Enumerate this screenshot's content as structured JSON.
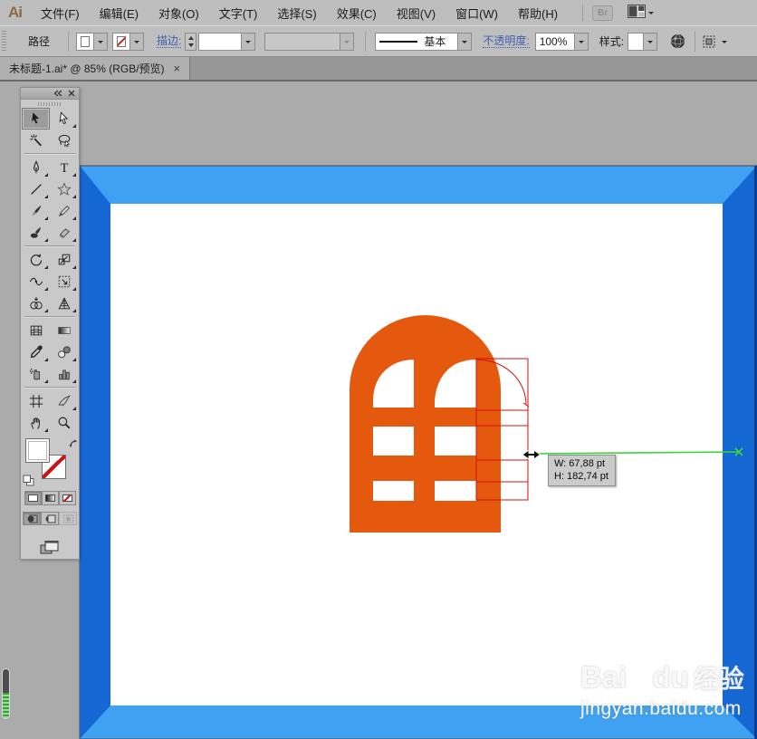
{
  "app": {
    "logo_label": "Ai"
  },
  "menu": {
    "items": [
      "文件(F)",
      "编辑(E)",
      "对象(O)",
      "文字(T)",
      "选择(S)",
      "效果(C)",
      "视图(V)",
      "窗口(W)",
      "帮助(H)"
    ],
    "bridge_button": "Br"
  },
  "control_bar": {
    "context_label": "路径",
    "stroke_label": "描边:",
    "brush_definition": "基本",
    "opacity_label": "不透明度:",
    "opacity_value": "100%",
    "style_label": "样式:"
  },
  "tab": {
    "title": "未标题-1.ai* @ 85% (RGB/预览)",
    "close_glyph": "×"
  },
  "selected_tool": "selection",
  "tools": [
    "selection",
    "direct-selection",
    "magic-wand",
    "lasso",
    "pen",
    "type",
    "line-segment",
    "star",
    "paintbrush",
    "pencil",
    "blob-brush",
    "eraser",
    "rotate",
    "scale",
    "width",
    "free-transform",
    "shape-builder",
    "perspective-grid",
    "mesh",
    "gradient",
    "eyedropper",
    "blend",
    "symbol-sprayer",
    "column-graph",
    "artboard",
    "slice",
    "hand",
    "zoom"
  ],
  "canvas": {
    "tooltip": {
      "width_text": "W: 67,88 pt",
      "height_text": "H: 182,74 pt"
    }
  },
  "watermark": {
    "brand_prefix": "Bai",
    "brand_mid": "du",
    "brand_suffix": "经验",
    "site_url": "jingyan.baidu.com"
  },
  "colors": {
    "frame_light_blue": "#3FA1F1",
    "frame_dark_blue": "#1567D3",
    "artwork_orange": "#E4590E",
    "wireframe_red": "#D6100E",
    "measure_green": "#3DD43D"
  }
}
